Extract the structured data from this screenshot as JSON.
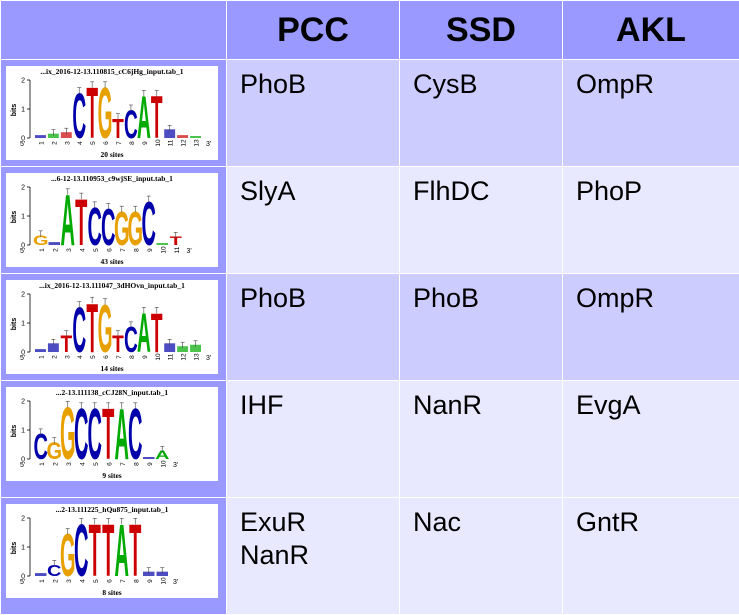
{
  "headers": [
    "",
    "PCC",
    "SSD",
    "AKL"
  ],
  "rows": [
    {
      "logo": {
        "title": "...ix_2016-12-13.110815_cC6jHg_input.tab_1",
        "sites": "20 sites",
        "letters": [
          "",
          "",
          "",
          "C",
          "T",
          "G",
          "T",
          "C",
          "A",
          "T",
          "",
          "",
          ""
        ],
        "colors": [
          "#00a",
          "#0a0",
          "#c00",
          "#00a",
          "#c00",
          "#e8a000",
          "#c00",
          "#00a",
          "#0a0",
          "#c00",
          "#00a",
          "#c00",
          "#0a0"
        ],
        "heights": [
          0.1,
          0.15,
          0.2,
          1.6,
          1.8,
          1.8,
          0.7,
          1.0,
          1.5,
          1.5,
          0.3,
          0.1,
          0.05
        ],
        "xticks": [
          "1",
          "2",
          "3",
          "4",
          "5",
          "6",
          "7",
          "8",
          "9",
          "10",
          "11",
          "12",
          "13"
        ],
        "ymax": "2"
      },
      "pcc": [
        "PhoB"
      ],
      "ssd": [
        "CysB"
      ],
      "akl": [
        "OmpR"
      ],
      "shade": "r1"
    },
    {
      "logo": {
        "title": "...6-12-13.110953_c9wjSE_input.tab_1",
        "sites": "43 sites",
        "letters": [
          "G",
          "",
          "A",
          "T",
          "C",
          "C",
          "G",
          "G",
          "C",
          "",
          "T"
        ],
        "colors": [
          "#e8a000",
          "#00a",
          "#0a0",
          "#c00",
          "#00a",
          "#00a",
          "#e8a000",
          "#e8a000",
          "#00a",
          "#0a0",
          "#c00"
        ],
        "heights": [
          0.35,
          0.1,
          1.8,
          1.65,
          1.35,
          1.3,
          1.2,
          1.2,
          1.55,
          0.05,
          0.3
        ],
        "xticks": [
          "1",
          "2",
          "3",
          "4",
          "5",
          "6",
          "7",
          "8",
          "9",
          "10",
          "11"
        ],
        "ymax": "2"
      },
      "pcc": [
        "SlyA"
      ],
      "ssd": [
        "FlhDC"
      ],
      "akl": [
        "PhoP"
      ],
      "shade": "r2"
    },
    {
      "logo": {
        "title": "...ix_2016-12-13.111047_3dHOvn_input.tab_1",
        "sites": "14 sites",
        "letters": [
          "",
          "",
          "T",
          "C",
          "T",
          "G",
          "T",
          "C",
          "A",
          "T",
          "",
          "",
          ""
        ],
        "colors": [
          "#00a",
          "#00a",
          "#c00",
          "#00a",
          "#c00",
          "#e8a000",
          "#c00",
          "#00a",
          "#0a0",
          "#c00",
          "#00a",
          "#0a0",
          "#0a0"
        ],
        "heights": [
          0.1,
          0.3,
          0.6,
          1.6,
          1.75,
          1.7,
          0.6,
          0.9,
          1.4,
          1.4,
          0.3,
          0.2,
          0.25
        ],
        "xticks": [
          "1",
          "2",
          "3",
          "4",
          "5",
          "6",
          "7",
          "8",
          "9",
          "10",
          "11",
          "12",
          "13"
        ],
        "ymax": "2"
      },
      "pcc": [
        "PhoB"
      ],
      "ssd": [
        "PhoB"
      ],
      "akl": [
        "OmpR"
      ],
      "shade": "r1",
      "ssd_highlight": true
    },
    {
      "logo": {
        "title": "...2-13.111138_cCJ28N_input.tab_1",
        "sites": "9 sites",
        "letters": [
          "C",
          "G",
          "G",
          "C",
          "C",
          "T",
          "A",
          "C",
          "",
          "A"
        ],
        "colors": [
          "#00a",
          "#e8a000",
          "#e8a000",
          "#00a",
          "#00a",
          "#c00",
          "#0a0",
          "#00a",
          "#00a",
          "#0a0"
        ],
        "heights": [
          0.9,
          0.6,
          1.85,
          1.8,
          1.8,
          1.8,
          1.8,
          1.8,
          0.05,
          0.3
        ],
        "xticks": [
          "1",
          "2",
          "3",
          "4",
          "5",
          "6",
          "7",
          "8",
          "9",
          "10"
        ],
        "ymax": "2"
      },
      "pcc": [
        "IHF"
      ],
      "ssd": [
        "NanR"
      ],
      "akl": [
        "EvgA"
      ],
      "shade": "r2"
    },
    {
      "logo": {
        "title": "...2-13.111225_hQu875_input.tab_1",
        "sites": "8 sites",
        "letters": [
          "",
          "C",
          "G",
          "C",
          "T",
          "T",
          "A",
          "T",
          "",
          ""
        ],
        "colors": [
          "#00a",
          "#00a",
          "#e8a000",
          "#00a",
          "#c00",
          "#c00",
          "#0a0",
          "#c00",
          "#00a",
          "#00a"
        ],
        "heights": [
          0.1,
          0.4,
          1.5,
          1.85,
          1.85,
          1.85,
          1.85,
          1.85,
          0.15,
          0.15
        ],
        "xticks": [
          "1",
          "2",
          "3",
          "4",
          "5",
          "6",
          "7",
          "8",
          "9",
          "10"
        ],
        "ymax": "2"
      },
      "pcc": [
        "ExuR",
        "NanR"
      ],
      "ssd": [
        "Nac"
      ],
      "akl": [
        "GntR"
      ],
      "shade": "r2"
    }
  ]
}
